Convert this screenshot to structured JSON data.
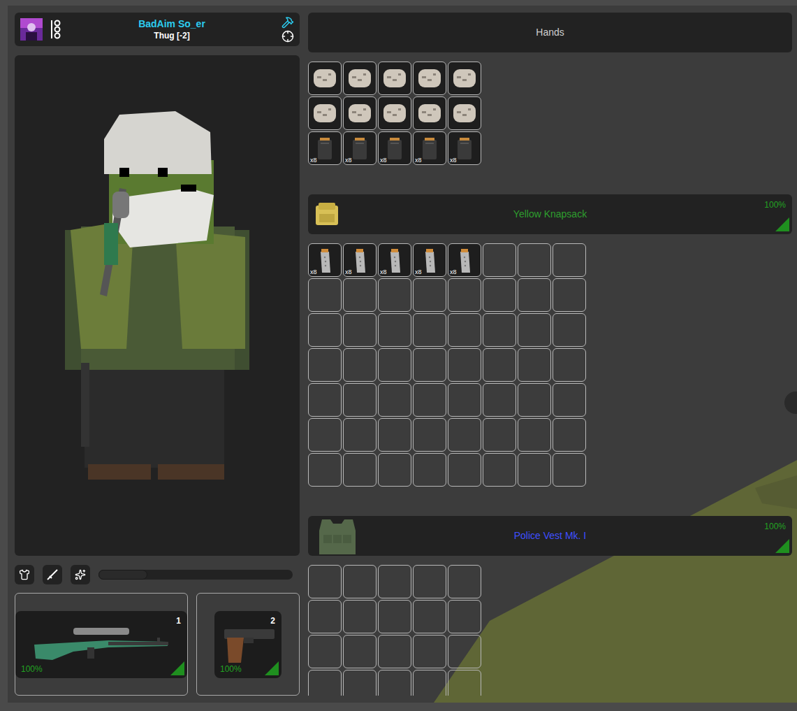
{
  "player": {
    "name": "BadAim So_er",
    "rank": "Thug [-2]"
  },
  "toolbar": {
    "slider": {
      "level": 0
    }
  },
  "weapons": [
    {
      "slot": "1",
      "condition": "100%",
      "kind": "rifle"
    },
    {
      "slot": "2",
      "condition": "100%",
      "kind": "pistol"
    }
  ],
  "containers": [
    {
      "title": "Hands",
      "kind": "hands",
      "color": "#d0d0d0",
      "rows": [
        [
          {
            "kind": "round"
          },
          {
            "kind": "round"
          },
          {
            "kind": "round"
          },
          {
            "kind": "round"
          },
          {
            "kind": "round"
          }
        ],
        [
          {
            "kind": "round"
          },
          {
            "kind": "round"
          },
          {
            "kind": "round"
          },
          {
            "kind": "round"
          },
          {
            "kind": "round"
          }
        ],
        [
          {
            "kind": "magazine",
            "count": "x8"
          },
          {
            "kind": "magazine",
            "count": "x8"
          },
          {
            "kind": "magazine",
            "count": "x8"
          },
          {
            "kind": "magazine",
            "count": "x8"
          },
          {
            "kind": "magazine",
            "count": "x8"
          }
        ]
      ]
    },
    {
      "title": "Yellow Knapsack",
      "kind": "backpack",
      "condition": "100%",
      "color": "#2e9e2e",
      "rows": [
        [
          {
            "kind": "pistol-magazine",
            "count": "x8"
          },
          {
            "kind": "pistol-magazine",
            "count": "x8"
          },
          {
            "kind": "pistol-magazine",
            "count": "x8"
          },
          {
            "kind": "pistol-magazine",
            "count": "x8"
          },
          {
            "kind": "pistol-magazine",
            "count": "x8"
          },
          {
            "kind": "empty"
          },
          {
            "kind": "empty"
          },
          {
            "kind": "empty"
          }
        ],
        [
          {
            "kind": "empty"
          },
          {
            "kind": "empty"
          },
          {
            "kind": "empty"
          },
          {
            "kind": "empty"
          },
          {
            "kind": "empty"
          },
          {
            "kind": "empty"
          },
          {
            "kind": "empty"
          },
          {
            "kind": "empty"
          }
        ],
        [
          {
            "kind": "empty"
          },
          {
            "kind": "empty"
          },
          {
            "kind": "empty"
          },
          {
            "kind": "empty"
          },
          {
            "kind": "empty"
          },
          {
            "kind": "empty"
          },
          {
            "kind": "empty"
          },
          {
            "kind": "empty"
          }
        ],
        [
          {
            "kind": "empty"
          },
          {
            "kind": "empty"
          },
          {
            "kind": "empty"
          },
          {
            "kind": "empty"
          },
          {
            "kind": "empty"
          },
          {
            "kind": "empty"
          },
          {
            "kind": "empty"
          },
          {
            "kind": "empty"
          }
        ],
        [
          {
            "kind": "empty"
          },
          {
            "kind": "empty"
          },
          {
            "kind": "empty"
          },
          {
            "kind": "empty"
          },
          {
            "kind": "empty"
          },
          {
            "kind": "empty"
          },
          {
            "kind": "empty"
          },
          {
            "kind": "empty"
          }
        ],
        [
          {
            "kind": "empty"
          },
          {
            "kind": "empty"
          },
          {
            "kind": "empty"
          },
          {
            "kind": "empty"
          },
          {
            "kind": "empty"
          },
          {
            "kind": "empty"
          },
          {
            "kind": "empty"
          },
          {
            "kind": "empty"
          }
        ],
        [
          {
            "kind": "empty"
          },
          {
            "kind": "empty"
          },
          {
            "kind": "empty"
          },
          {
            "kind": "empty"
          },
          {
            "kind": "empty"
          },
          {
            "kind": "empty"
          },
          {
            "kind": "empty"
          },
          {
            "kind": "empty"
          }
        ]
      ]
    },
    {
      "title": "Police Vest Mk. I",
      "kind": "vest",
      "condition": "100%",
      "color": "#3f4fff",
      "rows": [
        [
          {
            "kind": "empty"
          },
          {
            "kind": "empty"
          },
          {
            "kind": "empty"
          },
          {
            "kind": "empty"
          },
          {
            "kind": "empty"
          }
        ],
        [
          {
            "kind": "empty"
          },
          {
            "kind": "empty"
          },
          {
            "kind": "empty"
          },
          {
            "kind": "empty"
          },
          {
            "kind": "empty"
          }
        ],
        [
          {
            "kind": "empty"
          },
          {
            "kind": "empty"
          },
          {
            "kind": "empty"
          },
          {
            "kind": "empty"
          },
          {
            "kind": "empty"
          }
        ],
        [
          {
            "kind": "empty"
          },
          {
            "kind": "empty"
          },
          {
            "kind": "empty"
          },
          {
            "kind": "empty"
          },
          {
            "kind": "empty"
          }
        ]
      ]
    }
  ]
}
